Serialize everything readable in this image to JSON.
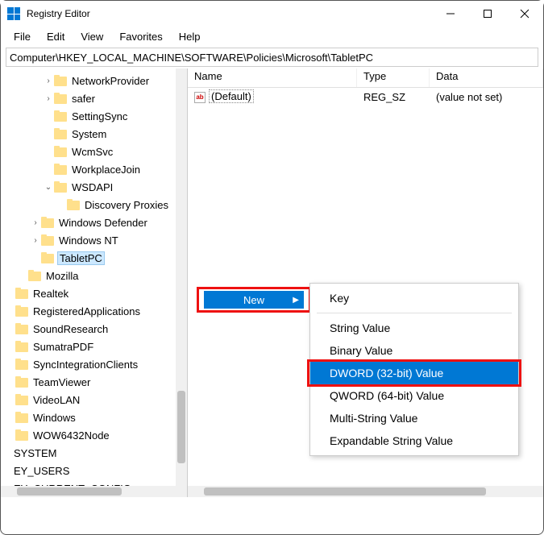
{
  "window": {
    "title": "Registry Editor"
  },
  "menubar": {
    "items": [
      "File",
      "Edit",
      "View",
      "Favorites",
      "Help"
    ]
  },
  "addressbar": {
    "path": "Computer\\HKEY_LOCAL_MACHINE\\SOFTWARE\\Policies\\Microsoft\\TabletPC"
  },
  "tree": {
    "items": [
      {
        "indent": 48,
        "chev": ">",
        "label": "NetworkProvider"
      },
      {
        "indent": 48,
        "chev": ">",
        "label": "safer"
      },
      {
        "indent": 48,
        "chev": "",
        "label": "SettingSync"
      },
      {
        "indent": 48,
        "chev": "",
        "label": "System"
      },
      {
        "indent": 48,
        "chev": "",
        "label": "WcmSvc"
      },
      {
        "indent": 48,
        "chev": "",
        "label": "WorkplaceJoin"
      },
      {
        "indent": 48,
        "chev": "v",
        "label": "WSDAPI"
      },
      {
        "indent": 64,
        "chev": "",
        "label": "Discovery Proxies"
      },
      {
        "indent": 32,
        "chev": ">",
        "label": "Windows Defender"
      },
      {
        "indent": 32,
        "chev": ">",
        "label": "Windows NT"
      },
      {
        "indent": 32,
        "chev": "",
        "label": "TabletPC",
        "selected": true
      },
      {
        "indent": 16,
        "chev": "",
        "label": "Mozilla"
      },
      {
        "indent": 0,
        "chev": "",
        "label": "Realtek"
      },
      {
        "indent": 0,
        "chev": "",
        "label": "RegisteredApplications"
      },
      {
        "indent": 0,
        "chev": "",
        "label": "SoundResearch"
      },
      {
        "indent": 0,
        "chev": "",
        "label": "SumatraPDF"
      },
      {
        "indent": 0,
        "chev": "",
        "label": "SyncIntegrationClients"
      },
      {
        "indent": 0,
        "chev": "",
        "label": "TeamViewer"
      },
      {
        "indent": 0,
        "chev": "",
        "label": "VideoLAN"
      },
      {
        "indent": 0,
        "chev": "",
        "label": "Windows"
      },
      {
        "indent": 0,
        "chev": "",
        "label": "WOW6432Node"
      },
      {
        "indent": -16,
        "chev": "",
        "label": "SYSTEM",
        "nofolder": true
      },
      {
        "indent": -16,
        "chev": "",
        "label": "EY_USERS",
        "nofolder": true
      },
      {
        "indent": -16,
        "chev": "",
        "label": "EY_CURRENT_CONFIG",
        "nofolder": true
      }
    ]
  },
  "list": {
    "columns": {
      "name": "Name",
      "type": "Type",
      "data": "Data"
    },
    "rows": [
      {
        "icon": "ab",
        "name": "(Default)",
        "type": "REG_SZ",
        "data": "(value not set)"
      }
    ]
  },
  "contextmenu": {
    "new_label": "New",
    "submenu": [
      {
        "label": "Key"
      },
      {
        "separator": true
      },
      {
        "label": "String Value"
      },
      {
        "label": "Binary Value"
      },
      {
        "label": "DWORD (32-bit) Value",
        "highlight": true
      },
      {
        "label": "QWORD (64-bit) Value"
      },
      {
        "label": "Multi-String Value"
      },
      {
        "label": "Expandable String Value"
      }
    ]
  }
}
